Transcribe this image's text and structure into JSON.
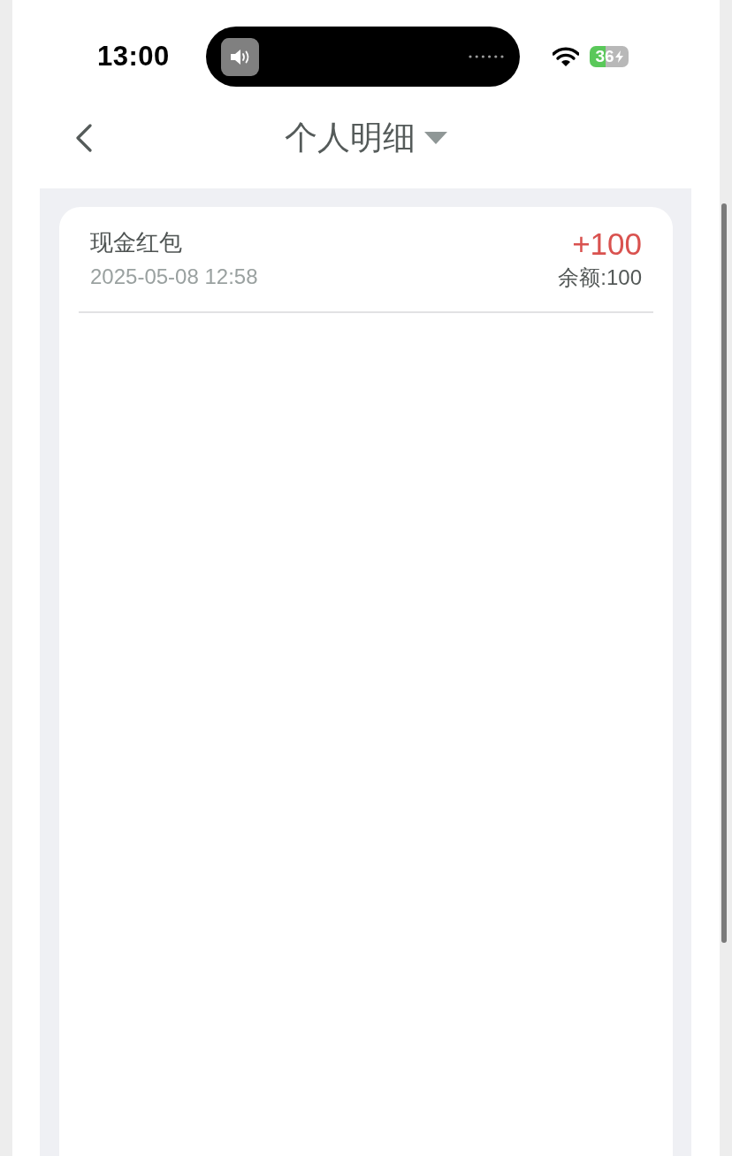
{
  "status_bar": {
    "time": "13:00",
    "battery": "36"
  },
  "nav": {
    "title": "个人明细"
  },
  "records": [
    {
      "name": "现金红包",
      "time": "2025-05-08 12:58",
      "amount": "+100",
      "balance": "余额:100"
    }
  ]
}
